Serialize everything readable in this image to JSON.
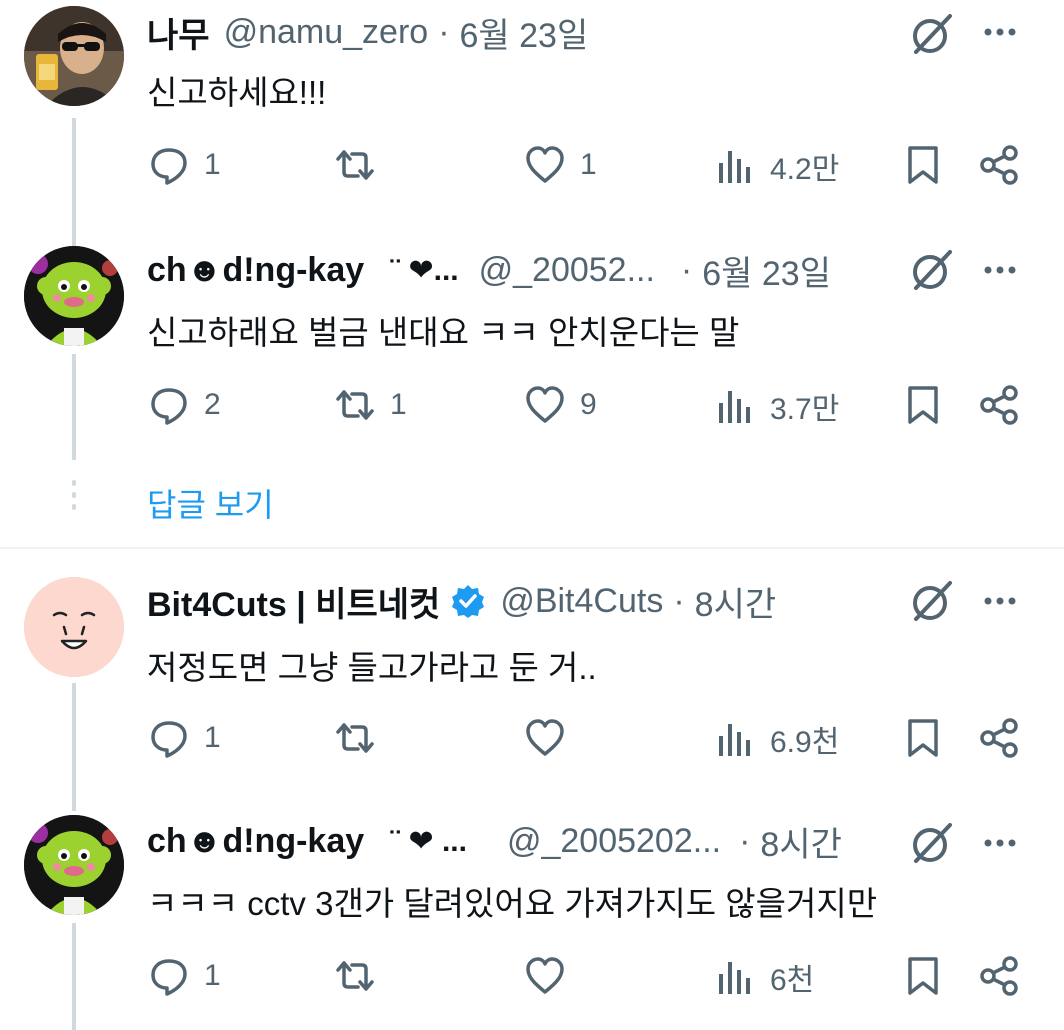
{
  "tweets": [
    {
      "name": "나무",
      "extra": "",
      "handle": "@namu_zero",
      "dot": "·",
      "time": "6월 23일",
      "text": "신고하세요!!!",
      "replies": "1",
      "retweets": "",
      "likes": "1",
      "views": "4.2만"
    },
    {
      "name": "ch☻d!ng-kay",
      "extra": "¨ ❤...",
      "handle": "@_20052...",
      "dot": "·",
      "time": "6월 23일",
      "text": "신고하래요 벌금 낸대요 ㅋㅋ 안치운다는 말",
      "replies": "2",
      "retweets": "1",
      "likes": "9",
      "views": "3.7만"
    },
    {
      "name": "Bit4Cuts | 비트네컷",
      "extra": "",
      "handle": "@Bit4Cuts",
      "dot": "·",
      "time": "8시간",
      "text": "저정도면 그냥 들고가라고 둔 거..",
      "replies": "1",
      "retweets": "",
      "likes": "",
      "views": "6.9천"
    },
    {
      "name": "ch☻d!ng-kay",
      "extra": "¨ ❤ ...",
      "handle": "@_2005202...",
      "dot": "·",
      "time": "8시간",
      "text": "ㅋㅋㅋ cctv 3갠가 달려있어요 가져가지도 않을거지만",
      "replies": "1",
      "retweets": "",
      "likes": "",
      "views": "6천"
    }
  ],
  "show_replies_label": "답글 보기",
  "colors": {
    "text": "#0f1419",
    "secondary": "#536471",
    "link": "#1d9bf0",
    "thread": "#cfd9de",
    "verified": "#1d9bf0"
  },
  "icons": [
    "reply-icon",
    "retweet-icon",
    "like-icon",
    "views-icon",
    "bookmark-icon",
    "share-icon",
    "grok-icon",
    "more-icon",
    "verified-badge-icon"
  ]
}
